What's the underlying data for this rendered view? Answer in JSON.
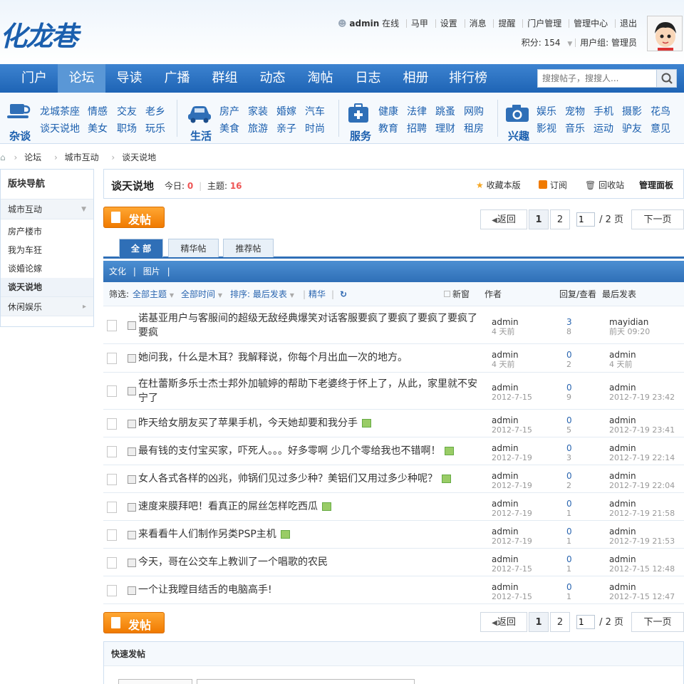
{
  "header": {
    "logo": "化龙巷",
    "username": "admin",
    "online": "在线",
    "links": [
      "马甲",
      "设置",
      "消息",
      "提醒",
      "门户管理",
      "管理中心",
      "退出"
    ],
    "points": "积分: 154",
    "usergroup": "用户组: 管理员"
  },
  "nav": {
    "items": [
      "门户",
      "论坛",
      "导读",
      "广播",
      "群组",
      "动态",
      "淘帖",
      "日志",
      "相册",
      "排行榜"
    ],
    "active": "论坛"
  },
  "search": {
    "placeholder": "搜搜帖子，搜搜人..."
  },
  "subnav": {
    "groups": [
      {
        "title": "杂谈",
        "links": [
          "龙城茶座",
          "情感",
          "交友",
          "老乡",
          "谈天说地",
          "美女",
          "职场",
          "玩乐"
        ]
      },
      {
        "title": "生活",
        "links": [
          "房产",
          "家装",
          "婚嫁",
          "汽车",
          "美食",
          "旅游",
          "亲子",
          "时尚"
        ]
      },
      {
        "title": "服务",
        "links": [
          "健康",
          "法律",
          "跳蚤",
          "网购",
          "教育",
          "招聘",
          "理财",
          "租房"
        ]
      },
      {
        "title": "兴趣",
        "links": [
          "娱乐",
          "宠物",
          "手机",
          "摄影",
          "花鸟",
          "影视",
          "音乐",
          "运动",
          "驴友",
          "意见"
        ]
      }
    ]
  },
  "breadcrumb": [
    "论坛",
    "城市互动",
    "谈天说地"
  ],
  "sidebar": {
    "title": "版块导航",
    "category1": "城市互动",
    "items": [
      "房产楼市",
      "我为车狂",
      "谈婚论嫁",
      "谈天说地"
    ],
    "active": "谈天说地",
    "category2": "休闲娱乐"
  },
  "forum": {
    "name": "谈天说地",
    "today_label": "今日:",
    "today": "0",
    "topics_label": "主题:",
    "topics": "16",
    "actions": [
      "收藏本版",
      "订阅",
      "回收站",
      "管理面板"
    ]
  },
  "post_button": "发帖",
  "pager": {
    "prev": "返回",
    "pages": [
      "1",
      "2"
    ],
    "current": "1",
    "total": "/ 2 页",
    "next": "下一页"
  },
  "tabs": [
    "全 部",
    "精华帖",
    "推荐帖"
  ],
  "typebar": [
    "文化",
    "图片"
  ],
  "filter": {
    "label": "筛选:",
    "theme": "全部主题",
    "time": "全部时间",
    "sort": "排序: 最后发表",
    "digest": "精华",
    "newwin": "新窗",
    "col_author": "作者",
    "col_reply": "回复/查看",
    "col_last": "最后发表"
  },
  "threads": [
    {
      "title": "诺基亚用户与客服间的超级无敌经典爆笑对话客服要疯了要疯了要疯了要疯了要疯",
      "pic": false,
      "author": "admin",
      "time": "4 天前",
      "replies": "3",
      "views": "8",
      "last_user": "mayidian",
      "last_time": "前天 09:20"
    },
    {
      "title": "她问我，什么是木耳？我解释说，你每个月出血一次的地方。",
      "pic": false,
      "author": "admin",
      "time": "4 天前",
      "replies": "0",
      "views": "2",
      "last_user": "admin",
      "last_time": "4 天前"
    },
    {
      "title": "在杜蕾斯多乐士杰士邦外加毓婷的帮助下老婆终于怀上了，从此，家里就不安宁了",
      "pic": false,
      "author": "admin",
      "time": "2012-7-15",
      "replies": "0",
      "views": "9",
      "last_user": "admin",
      "last_time": "2012-7-19 23:42"
    },
    {
      "title": "昨天给女朋友买了苹果手机，今天她却要和我分手",
      "pic": true,
      "author": "admin",
      "time": "2012-7-15",
      "replies": "0",
      "views": "5",
      "last_user": "admin",
      "last_time": "2012-7-19 23:41"
    },
    {
      "title": "最有钱的支付宝买家，吓死人。。。好多零啊 少几个零给我也不错啊！",
      "pic": true,
      "author": "admin",
      "time": "2012-7-19",
      "replies": "0",
      "views": "3",
      "last_user": "admin",
      "last_time": "2012-7-19 22:14"
    },
    {
      "title": "女人各式各样的凶兆，帅锅们见过多少种？美铝们又用过多少种呢？",
      "pic": true,
      "author": "admin",
      "time": "2012-7-19",
      "replies": "0",
      "views": "2",
      "last_user": "admin",
      "last_time": "2012-7-19 22:04"
    },
    {
      "title": "速度来膜拜吧！看真正的屌丝怎样吃西瓜",
      "pic": true,
      "author": "admin",
      "time": "2012-7-19",
      "replies": "0",
      "views": "1",
      "last_user": "admin",
      "last_time": "2012-7-19 21:58"
    },
    {
      "title": "来看看牛人们制作另类PSP主机",
      "pic": true,
      "author": "admin",
      "time": "2012-7-19",
      "replies": "0",
      "views": "1",
      "last_user": "admin",
      "last_time": "2012-7-19 21:53"
    },
    {
      "title": "今天，哥在公交车上教训了一个唱歌的农民",
      "pic": false,
      "author": "admin",
      "time": "2012-7-15",
      "replies": "0",
      "views": "1",
      "last_user": "admin",
      "last_time": "2012-7-15 12:48"
    },
    {
      "title": "一个让我瞠目结舌的电脑高手!",
      "pic": false,
      "author": "admin",
      "time": "2012-7-15",
      "replies": "0",
      "views": "1",
      "last_user": "admin",
      "last_time": "2012-7-15 12:47"
    }
  ],
  "quick_post": "快速发帖"
}
